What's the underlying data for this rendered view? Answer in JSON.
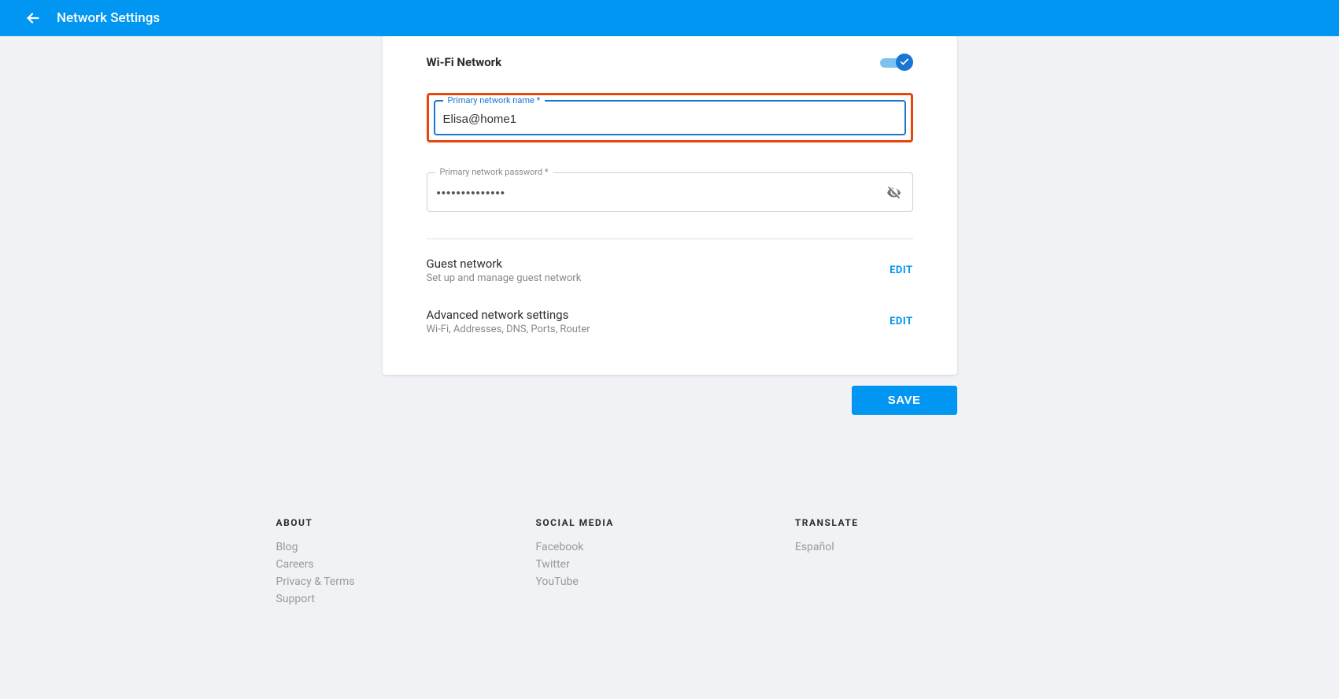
{
  "header": {
    "title": "Network Settings"
  },
  "wifi": {
    "section": "Wi-Fi Network",
    "name_label": "Primary network name *",
    "name_value": "Elisa@home1",
    "pass_label": "Primary network password *",
    "pass_value": "••••••••••••••"
  },
  "guest": {
    "title": "Guest network",
    "sub": "Set up and manage guest network",
    "edit": "EDIT"
  },
  "advanced": {
    "title": "Advanced network settings",
    "sub": "Wi-Fi, Addresses, DNS, Ports, Router",
    "edit": "EDIT"
  },
  "save": "SAVE",
  "footer": {
    "about": {
      "h": "ABOUT",
      "links": [
        "Blog",
        "Careers",
        "Privacy & Terms",
        "Support"
      ]
    },
    "social": {
      "h": "SOCIAL MEDIA",
      "links": [
        "Facebook",
        "Twitter",
        "YouTube"
      ]
    },
    "translate": {
      "h": "TRANSLATE",
      "links": [
        "Español"
      ]
    }
  }
}
